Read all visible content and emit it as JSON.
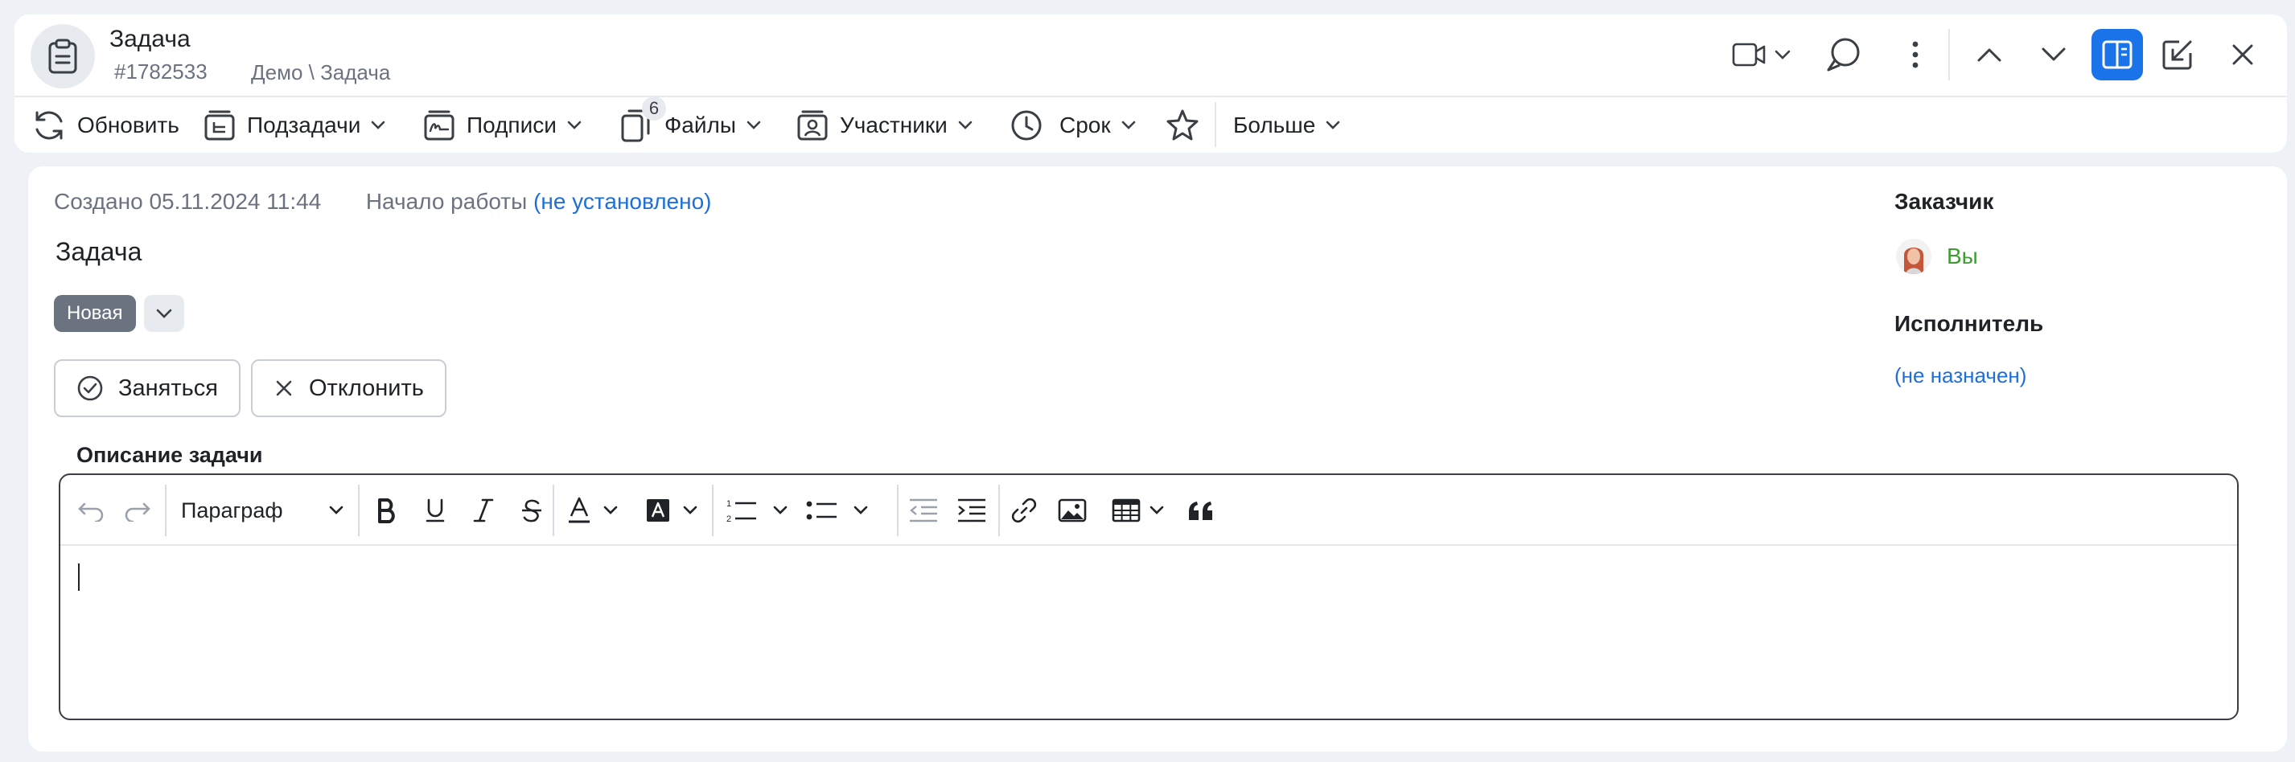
{
  "header": {
    "title": "Задача",
    "task_id": "#1782533",
    "path": "Демо \\ Задача",
    "icons": [
      "clipboard-icon",
      "video-icon",
      "chat-icon",
      "more-vertical-icon",
      "chevron-up-icon",
      "chevron-down-icon",
      "split-view-icon",
      "minimize-icon",
      "close-icon"
    ]
  },
  "toolbar": {
    "refresh": "Обновить",
    "subtasks": "Подзадачи",
    "signatures": "Подписи",
    "files": "Файлы",
    "files_count": "6",
    "participants": "Участники",
    "deadline": "Срок",
    "more": "Больше"
  },
  "task": {
    "created_label": "Создано",
    "created_value": "05.11.2024 11:44",
    "start_label": "Начало работы",
    "start_value": "(не установлено)",
    "name": "Задача",
    "status": "Новая",
    "take_button": "Заняться",
    "reject_button": "Отклонить",
    "description_label": "Описание задачи"
  },
  "editor": {
    "paragraph_style": "Параграф"
  },
  "sidebar": {
    "customer_label": "Заказчик",
    "customer_name": "Вы",
    "assignee_label": "Исполнитель",
    "assignee_value": "(не назначен)"
  },
  "colors": {
    "accent": "#1f6fd6",
    "active_button": "#1a73e8",
    "status_pill": "#6b7280",
    "customer_name": "#3f9c35",
    "background": "#eef1f5"
  }
}
